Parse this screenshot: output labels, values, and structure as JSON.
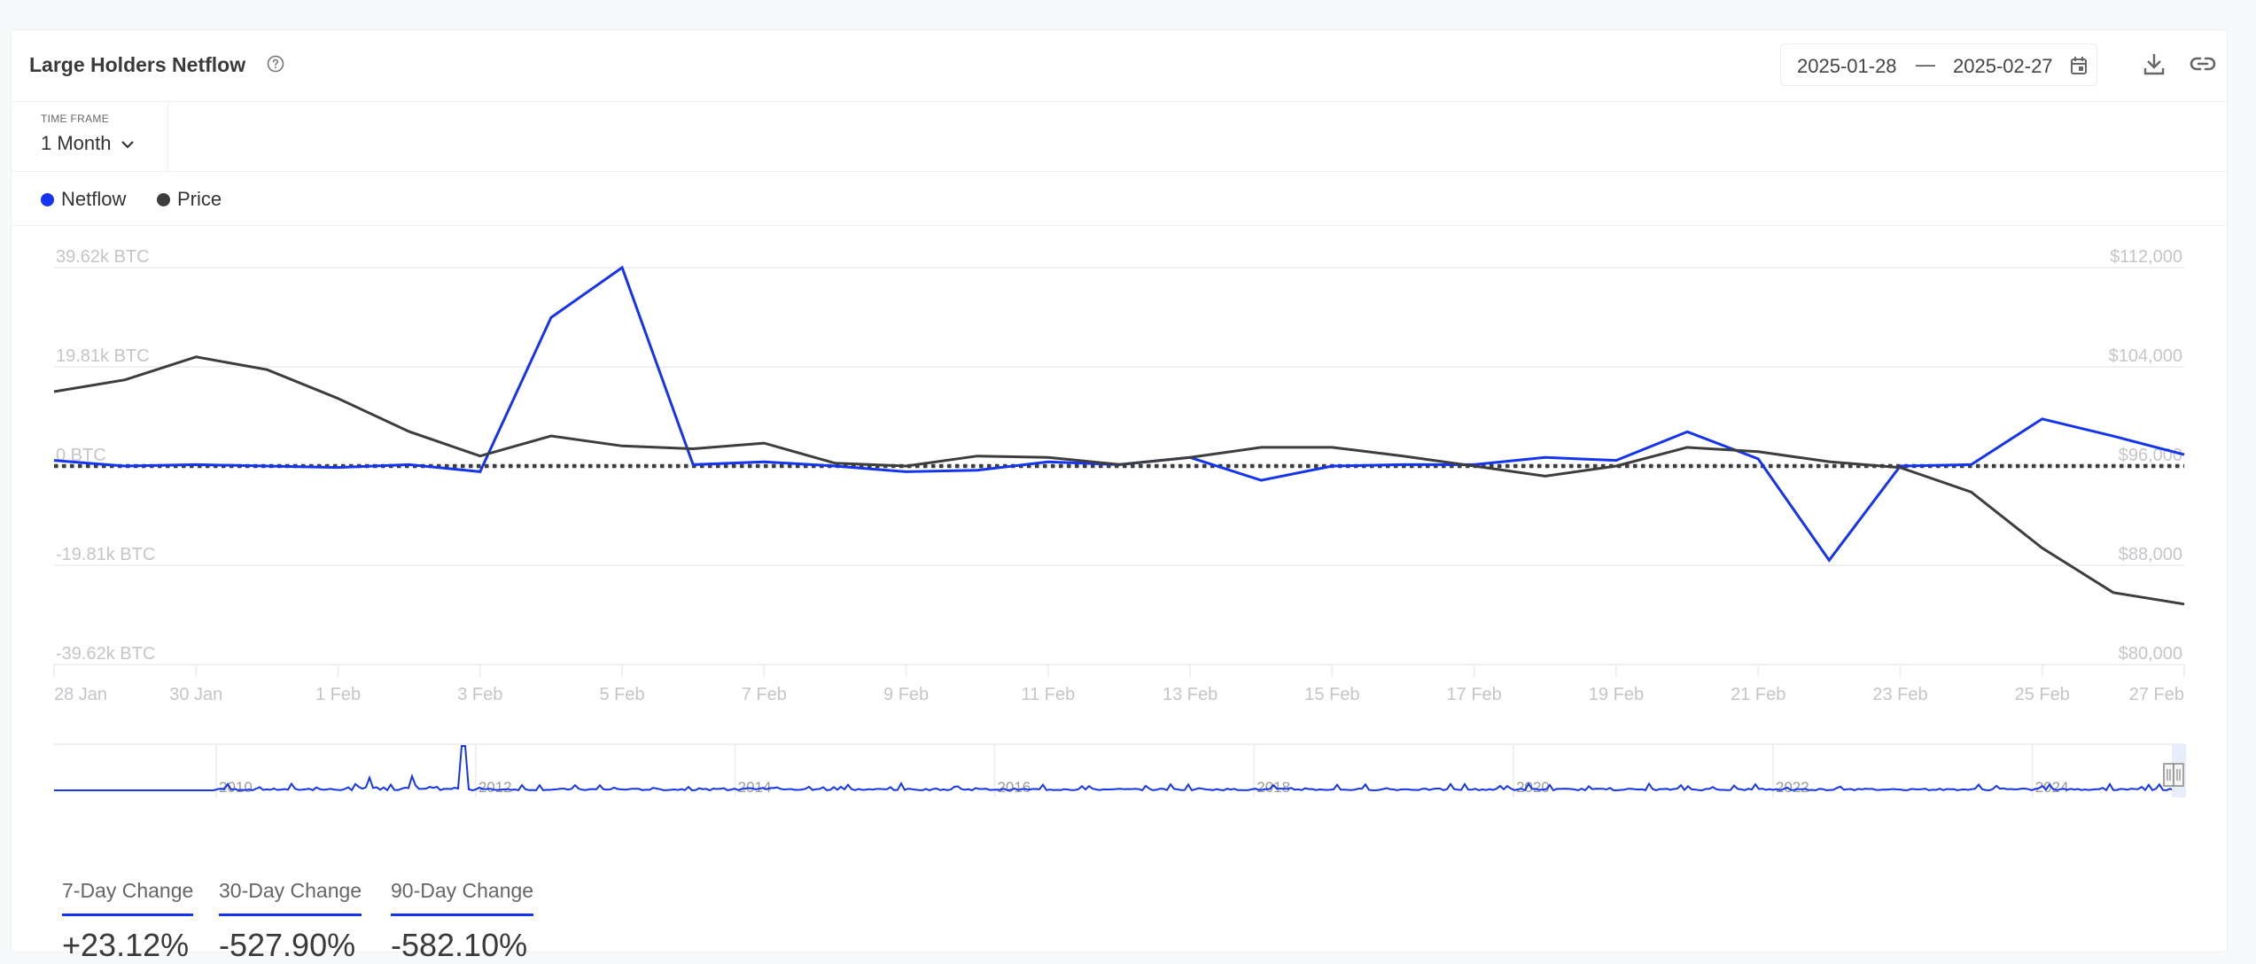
{
  "header": {
    "title": "Large Holders Netflow",
    "help_icon": "question-circle-icon",
    "date_start": "2025-01-28",
    "date_separator": "—",
    "date_end": "2025-02-27",
    "calendar_icon": "calendar-icon",
    "download_icon": "download-icon",
    "link_icon": "link-icon"
  },
  "timeframe": {
    "label": "TIME FRAME",
    "value": "1 Month"
  },
  "legend": [
    {
      "name": "Netflow",
      "color": "#1434f0"
    },
    {
      "name": "Price",
      "color": "#3d3d3d"
    }
  ],
  "chart_data": {
    "type": "line",
    "title": "Large Holders Netflow",
    "x": [
      "28 Jan",
      "29 Jan",
      "30 Jan",
      "31 Jan",
      "1 Feb",
      "2 Feb",
      "3 Feb",
      "4 Feb",
      "5 Feb",
      "6 Feb",
      "7 Feb",
      "8 Feb",
      "9 Feb",
      "10 Feb",
      "11 Feb",
      "12 Feb",
      "13 Feb",
      "14 Feb",
      "15 Feb",
      "16 Feb",
      "17 Feb",
      "18 Feb",
      "19 Feb",
      "20 Feb",
      "21 Feb",
      "22 Feb",
      "23 Feb",
      "24 Feb",
      "25 Feb",
      "26 Feb",
      "27 Feb"
    ],
    "x_tick_labels": [
      "28 Jan",
      "30 Jan",
      "1 Feb",
      "3 Feb",
      "5 Feb",
      "7 Feb",
      "9 Feb",
      "11 Feb",
      "13 Feb",
      "15 Feb",
      "17 Feb",
      "19 Feb",
      "21 Feb",
      "23 Feb",
      "25 Feb",
      "27 Feb"
    ],
    "series": [
      {
        "name": "Netflow",
        "axis": "left",
        "unit": "BTC",
        "color": "#1434f0",
        "values": [
          1140,
          0,
          285,
          0,
          -285,
          285,
          -1140,
          29640,
          39620,
          285,
          855,
          0,
          -1140,
          -855,
          855,
          285,
          1710,
          -2850,
          0,
          285,
          285,
          1710,
          1140,
          6840,
          1425,
          -18810,
          0,
          285,
          9405,
          5985,
          2280
        ]
      },
      {
        "name": "Price",
        "axis": "right",
        "unit": "USD",
        "color": "#3d3d3d",
        "values": [
          102000,
          102950,
          104800,
          103770,
          101450,
          98780,
          96810,
          98430,
          97620,
          97390,
          97850,
          96230,
          96000,
          96810,
          96700,
          96120,
          96700,
          97510,
          97510,
          96810,
          96000,
          95190,
          96000,
          97510,
          97160,
          96350,
          95880,
          93910,
          89390,
          85800,
          84870
        ]
      }
    ],
    "y_left": {
      "ticks": [
        "39.62k BTC",
        "19.81k BTC",
        "0 BTC",
        "-19.81k BTC",
        "-39.62k BTC"
      ],
      "range": [
        -39620,
        39620
      ]
    },
    "y_right": {
      "ticks": [
        "$112,000",
        "$104,000",
        "$96,000",
        "$88,000",
        "$80,000"
      ],
      "range": [
        80000,
        112000
      ]
    },
    "zero_line": "dotted",
    "grid": true,
    "legend_position": "top-left",
    "navigator": {
      "year_labels": [
        "2010",
        "2012",
        "2014",
        "2016",
        "2018",
        "2020",
        "2022",
        "2024"
      ],
      "series": "Netflow"
    }
  },
  "stats": [
    {
      "label": "7-Day Change",
      "value": "+23.12%"
    },
    {
      "label": "30-Day Change",
      "value": "-527.90%"
    },
    {
      "label": "90-Day Change",
      "value": "-582.10%"
    }
  ]
}
